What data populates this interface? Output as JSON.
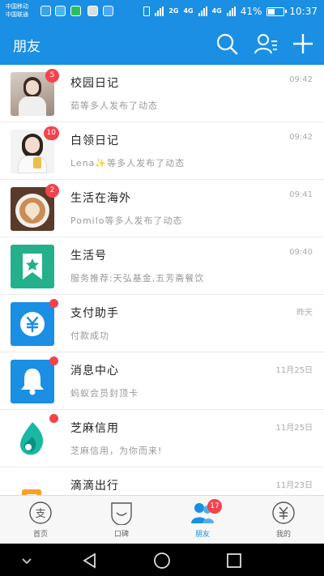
{
  "status_bar": {
    "carrier1": "中国移动",
    "carrier2": "中国联通",
    "net1": "2G",
    "net2": "4G",
    "net3": "4G",
    "battery": "41%",
    "battery_level": 0.41,
    "time": "10:37"
  },
  "header": {
    "title": "朋友",
    "icons": [
      "search-icon",
      "contacts-icon",
      "add-icon"
    ]
  },
  "conversations": [
    {
      "title": "校园日记",
      "subtitle": "茹等多人发布了动态",
      "time": "09:42",
      "badge": "5",
      "avatar": "girl-photo"
    },
    {
      "title": "白领日记",
      "subtitle": "Lena✨等多人发布了动态",
      "time": "09:42",
      "badge": "10",
      "avatar": "woman-photo"
    },
    {
      "title": "生活在海外",
      "subtitle": "Pomilo等多人发布了动态",
      "time": "09:41",
      "badge": "2",
      "avatar": "coffee-photo"
    },
    {
      "title": "生活号",
      "subtitle": "服务推荐:天弘基金,五芳斋餐饮",
      "time": "09:40",
      "badge": "",
      "avatar": "bookmark-star-icon"
    },
    {
      "title": "支付助手",
      "subtitle": "付款成功",
      "time": "昨天",
      "dot": true,
      "avatar": "yen-icon"
    },
    {
      "title": "消息中心",
      "subtitle": "蚂蚁会员封顶卡",
      "time": "11月25日",
      "dot": true,
      "avatar": "bell-icon"
    },
    {
      "title": "芝麻信用",
      "subtitle": "芝麻信用，为你而来!",
      "time": "11月25日",
      "dot": true,
      "avatar": "sesame-icon"
    },
    {
      "title": "滴滴出行",
      "subtitle": "",
      "time": "11月23日",
      "badge": "",
      "avatar": "didi-icon"
    }
  ],
  "tabs": [
    {
      "label": "首页",
      "icon": "home-icon"
    },
    {
      "label": "口碑",
      "icon": "koubei-icon"
    },
    {
      "label": "朋友",
      "icon": "friends-icon",
      "badge": "17",
      "active": true
    },
    {
      "label": "我的",
      "icon": "mine-icon"
    }
  ],
  "colors": {
    "accent": "#1a8fe3",
    "badge": "#f4424b"
  }
}
